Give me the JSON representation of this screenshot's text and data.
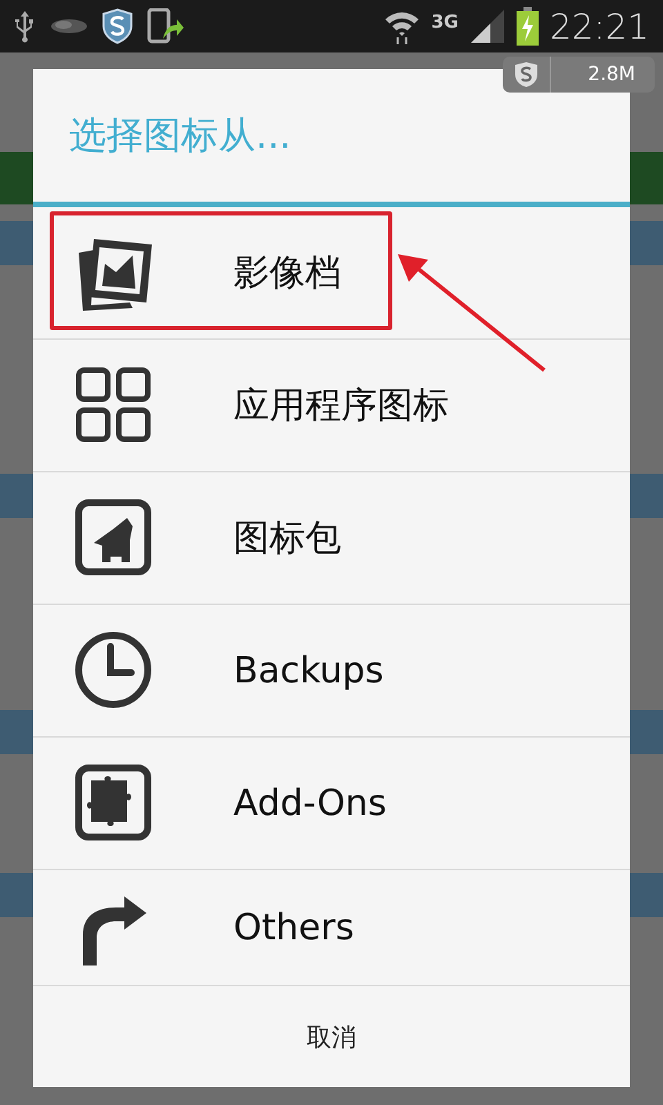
{
  "status_bar": {
    "network": "3G",
    "time": "22:21"
  },
  "memory_badge": {
    "text": "2.8M"
  },
  "dialog": {
    "title": "选择图标从...",
    "items": [
      {
        "kind": "gallery",
        "label": "影像档",
        "highlighted": true
      },
      {
        "kind": "apps",
        "label": "应用程序图标",
        "highlighted": false
      },
      {
        "kind": "iconpack",
        "label": "图标包",
        "highlighted": false
      },
      {
        "kind": "backups",
        "label": "Backups",
        "highlighted": false
      },
      {
        "kind": "addons",
        "label": "Add-Ons",
        "highlighted": false
      },
      {
        "kind": "others",
        "label": "Others",
        "highlighted": false
      }
    ],
    "cancel": "取消"
  }
}
